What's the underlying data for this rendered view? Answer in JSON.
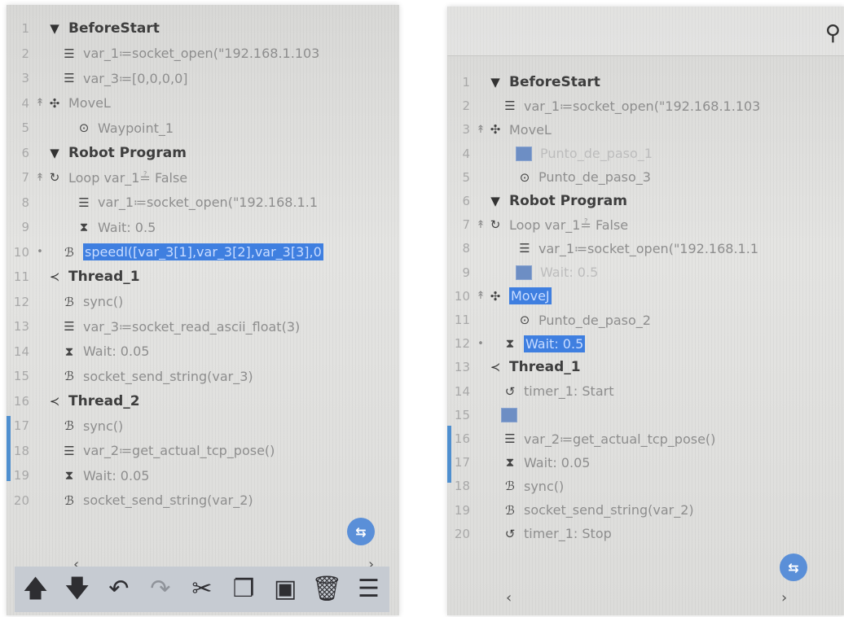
{
  "left": {
    "tree": [
      {
        "line": "1",
        "icon": "▼",
        "text": "BeforeStart",
        "depth": 0,
        "kind": "header",
        "marker": ""
      },
      {
        "line": "2",
        "icon": "☰",
        "text": "var_1≔socket_open(\"192.168.1.103",
        "depth": 1,
        "kind": "",
        "marker": ""
      },
      {
        "line": "3",
        "icon": "☰",
        "text": "var_3≔[0,0,0,0]",
        "depth": 1,
        "kind": "",
        "marker": ""
      },
      {
        "line": "4",
        "icon": "✣",
        "text": "MoveL",
        "depth": 0,
        "kind": "",
        "marker": "↟"
      },
      {
        "line": "5",
        "icon": "⊙",
        "text": "Waypoint_1",
        "depth": 2,
        "kind": "",
        "marker": ""
      },
      {
        "line": "6",
        "icon": "▼",
        "text": "Robot Program",
        "depth": 0,
        "kind": "header",
        "marker": ""
      },
      {
        "line": "7",
        "icon": "↻",
        "text": "Loop var_1≟ False",
        "depth": 0,
        "kind": "",
        "marker": "↟"
      },
      {
        "line": "8",
        "icon": "☰",
        "text": "var_1≔socket_open(\"192.168.1.1",
        "depth": 2,
        "kind": "",
        "marker": ""
      },
      {
        "line": "9",
        "icon": "⧗",
        "text": "Wait: 0.5",
        "depth": 2,
        "kind": "",
        "marker": ""
      },
      {
        "line": "10",
        "icon": "ℬ",
        "text": "speedl([var_3[1],var_3[2],var_3[3],0",
        "depth": 1,
        "kind": "selected",
        "marker": "•"
      },
      {
        "line": "11",
        "icon": "≺",
        "text": "Thread_1",
        "depth": 0,
        "kind": "header",
        "marker": ""
      },
      {
        "line": "12",
        "icon": "ℬ",
        "text": "sync()",
        "depth": 1,
        "kind": "",
        "marker": ""
      },
      {
        "line": "13",
        "icon": "☰",
        "text": "var_3≔socket_read_ascii_float(3)",
        "depth": 1,
        "kind": "",
        "marker": ""
      },
      {
        "line": "14",
        "icon": "⧗",
        "text": "Wait: 0.05",
        "depth": 1,
        "kind": "",
        "marker": ""
      },
      {
        "line": "15",
        "icon": "ℬ",
        "text": "socket_send_string(var_3)",
        "depth": 1,
        "kind": "",
        "marker": ""
      },
      {
        "line": "16",
        "icon": "≺",
        "text": "Thread_2",
        "depth": 0,
        "kind": "header",
        "marker": ""
      },
      {
        "line": "17",
        "icon": "ℬ",
        "text": "sync()",
        "depth": 1,
        "kind": "",
        "marker": ""
      },
      {
        "line": "18",
        "icon": "☰",
        "text": "var_2≔get_actual_tcp_pose()",
        "depth": 1,
        "kind": "",
        "marker": ""
      },
      {
        "line": "19",
        "icon": "⧗",
        "text": "Wait: 0.05",
        "depth": 1,
        "kind": "",
        "marker": ""
      },
      {
        "line": "20",
        "icon": "ℬ",
        "text": "socket_send_string(var_2)",
        "depth": 1,
        "kind": "",
        "marker": ""
      }
    ],
    "scroll_left": "‹",
    "scroll_right": "›",
    "fab_icon": "arrow-right-left-icon",
    "toolbar": [
      "move-up-icon",
      "move-down-icon",
      "undo-icon",
      "redo-icon",
      "cut-icon",
      "copy-icon",
      "paste-icon",
      "delete-icon",
      "suppress-icon"
    ]
  },
  "right": {
    "tree": [
      {
        "line": "1",
        "icon": "▼",
        "text": "BeforeStart",
        "depth": 0,
        "kind": "header",
        "marker": ""
      },
      {
        "line": "2",
        "icon": "☰",
        "text": "var_1≔socket_open(\"192.168.1.103",
        "depth": 1,
        "kind": "",
        "marker": ""
      },
      {
        "line": "3",
        "icon": "✣",
        "text": "MoveL",
        "depth": 0,
        "kind": "",
        "marker": "↟"
      },
      {
        "line": "4",
        "icon": "",
        "text": "Punto_de_paso_1",
        "depth": 2,
        "kind": "dim-block",
        "marker": ""
      },
      {
        "line": "5",
        "icon": "⊙",
        "text": "Punto_de_paso_3",
        "depth": 2,
        "kind": "",
        "marker": ""
      },
      {
        "line": "6",
        "icon": "▼",
        "text": "Robot Program",
        "depth": 0,
        "kind": "header",
        "marker": ""
      },
      {
        "line": "7",
        "icon": "↻",
        "text": "Loop var_1≟ False",
        "depth": 0,
        "kind": "",
        "marker": "↟"
      },
      {
        "line": "8",
        "icon": "☰",
        "text": "var_1≔socket_open(\"192.168.1.1",
        "depth": 2,
        "kind": "",
        "marker": ""
      },
      {
        "line": "9",
        "icon": "",
        "text": "Wait: 0.5",
        "depth": 2,
        "kind": "dim-block",
        "marker": ""
      },
      {
        "line": "10",
        "icon": "✣",
        "text": "MoveJ",
        "depth": 0,
        "kind": "selected",
        "marker": "↟"
      },
      {
        "line": "11",
        "icon": "⊙",
        "text": "Punto_de_paso_2",
        "depth": 2,
        "kind": "",
        "marker": ""
      },
      {
        "line": "12",
        "icon": "⧗",
        "text": "Wait: 0.5",
        "depth": 1,
        "kind": "selected",
        "marker": "•"
      },
      {
        "line": "13",
        "icon": "≺",
        "text": "Thread_1",
        "depth": 0,
        "kind": "header",
        "marker": ""
      },
      {
        "line": "14",
        "icon": "↺",
        "text": "timer_1: Start",
        "depth": 1,
        "kind": "",
        "marker": ""
      },
      {
        "line": "15",
        "icon": "",
        "text": "",
        "depth": 1,
        "kind": "dim-block",
        "marker": ""
      },
      {
        "line": "16",
        "icon": "☰",
        "text": "var_2≔get_actual_tcp_pose()",
        "depth": 1,
        "kind": "",
        "marker": ""
      },
      {
        "line": "17",
        "icon": "⧗",
        "text": "Wait: 0.05",
        "depth": 1,
        "kind": "",
        "marker": ""
      },
      {
        "line": "18",
        "icon": "ℬ",
        "text": "sync()",
        "depth": 1,
        "kind": "",
        "marker": ""
      },
      {
        "line": "19",
        "icon": "ℬ",
        "text": "socket_send_string(var_2)",
        "depth": 1,
        "kind": "",
        "marker": ""
      },
      {
        "line": "20",
        "icon": "↺",
        "text": "timer_1: Stop",
        "depth": 1,
        "kind": "",
        "marker": ""
      }
    ],
    "search_icon": "search-icon",
    "scroll_left": "‹",
    "scroll_right": "›",
    "fab_icon": "arrow-right-left-icon"
  },
  "colors": {
    "selection": "#3f7fe0",
    "fab": "#5a8fd8",
    "toolbar": "#c6cbd2",
    "accent_tab": "#4f8fcf"
  }
}
